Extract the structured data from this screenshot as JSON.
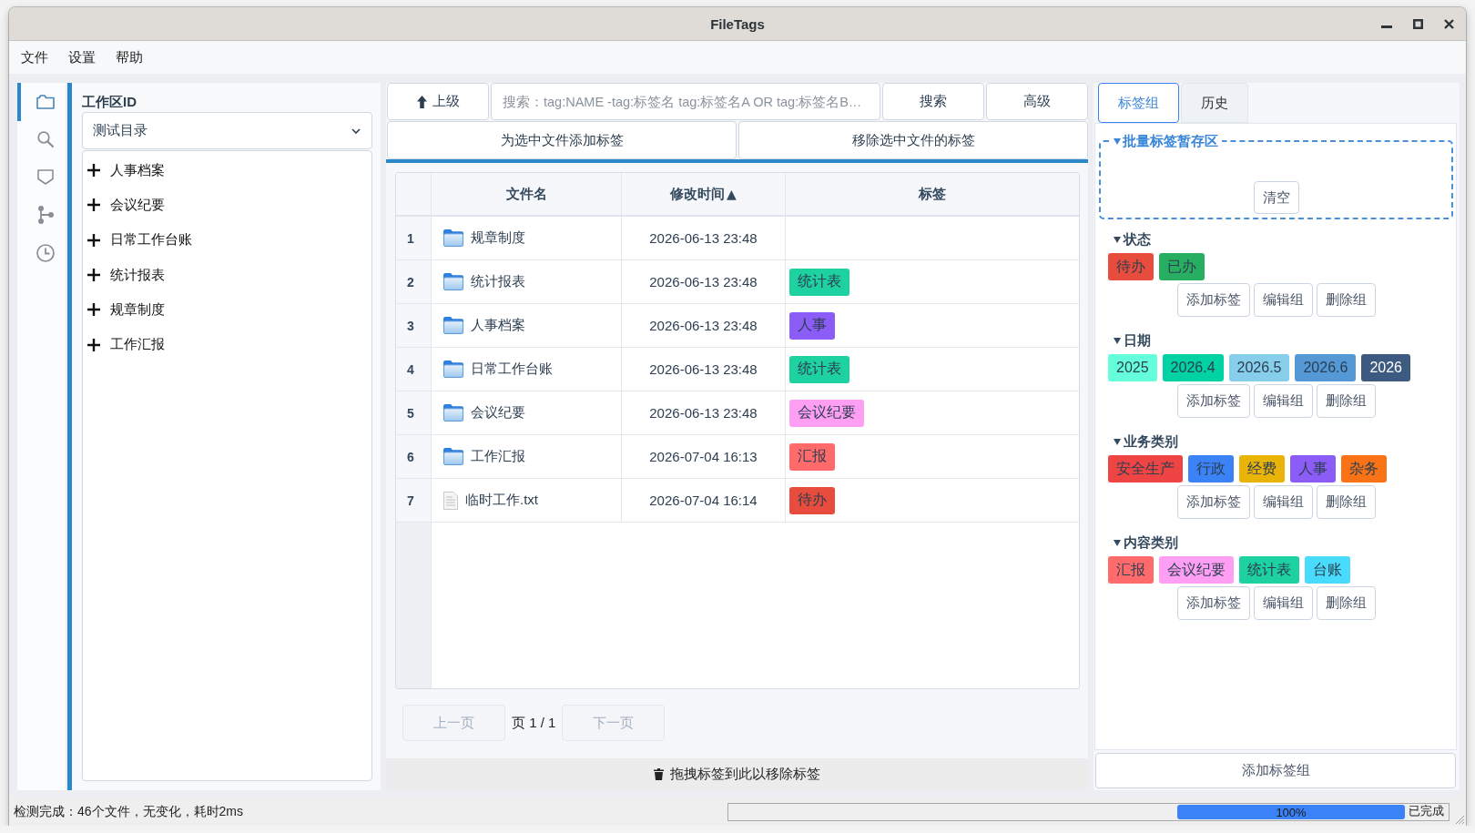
{
  "window": {
    "title": "FileTags"
  },
  "menu": [
    "文件",
    "设置",
    "帮助"
  ],
  "activity_bar": [
    {
      "kind": "files",
      "selected": true
    },
    {
      "kind": "search",
      "selected": false
    },
    {
      "kind": "tags",
      "selected": false
    },
    {
      "kind": "tree",
      "selected": false
    },
    {
      "kind": "history",
      "selected": false
    }
  ],
  "workspace": {
    "label": "工作区ID",
    "dropdown": {
      "value": "测试目录"
    },
    "tree": [
      {
        "label": "人事档案",
        "expanded": false
      },
      {
        "label": "会议纪要",
        "expanded": false
      },
      {
        "label": "日常工作台账",
        "expanded": false
      },
      {
        "label": "统计报表",
        "expanded": false
      },
      {
        "label": "规章制度",
        "expanded": false
      },
      {
        "label": "工作汇报",
        "expanded": false
      }
    ]
  },
  "toolbar": {
    "up_button": "上级",
    "search": {
      "placeholder": "搜索：tag:NAME -tag:标签名 tag:标签名A OR tag:标签名B…"
    },
    "search_button": "搜索",
    "advanced_button": "高级",
    "add_tags_button": "为选中文件添加标签",
    "remove_tags_button": "移除选中文件的标签"
  },
  "table": {
    "columns": [
      {
        "label": "文件名"
      },
      {
        "label": "修改时间",
        "sort_indicator": "▲"
      },
      {
        "label": "标签"
      }
    ],
    "rows": [
      {
        "index": "1",
        "kind": "folder",
        "name": "规章制度",
        "modified": "2026-06-13 23:48"
      },
      {
        "index": "2",
        "kind": "folder",
        "name": "统计报表",
        "modified": "2026-06-13 23:48",
        "tags": [
          {
            "label": "统计表",
            "color": "#1dd1a1"
          }
        ]
      },
      {
        "index": "3",
        "kind": "folder",
        "name": "人事档案",
        "modified": "2026-06-13 23:48",
        "tags": [
          {
            "label": "人事",
            "color": "#8b5cf6"
          }
        ]
      },
      {
        "index": "4",
        "kind": "folder",
        "name": "日常工作台账",
        "modified": "2026-06-13 23:48",
        "tags": [
          {
            "label": "统计表",
            "color": "#1dd1a1"
          }
        ]
      },
      {
        "index": "5",
        "kind": "folder",
        "name": "会议纪要",
        "modified": "2026-06-13 23:48",
        "tags": [
          {
            "label": "会议纪要",
            "color": "#ff9ff3"
          }
        ]
      },
      {
        "index": "6",
        "kind": "folder",
        "name": "工作汇报",
        "modified": "2026-07-04 16:13",
        "tags": [
          {
            "label": "汇报",
            "color": "#ff6b6b"
          }
        ]
      },
      {
        "index": "7",
        "kind": "file",
        "name": "临时工作.txt",
        "modified": "2026-07-04 16:14",
        "tags": [
          {
            "label": "待办",
            "color": "#e74c3c"
          }
        ]
      }
    ]
  },
  "pagination": {
    "previous": {
      "label": "上一页",
      "disabled": true
    },
    "page": "页 1 / 1",
    "next": {
      "label": "下一页",
      "disabled": true
    }
  },
  "drop_zone": {
    "text": "拖拽标签到此以移除标签"
  },
  "tag_panel": {
    "tabs": [
      {
        "label": "标签组",
        "selected": true
      },
      {
        "label": "历史",
        "selected": false
      }
    ],
    "staging": {
      "title": "批量标签暂存区",
      "expanded": true,
      "clear_button": "清空"
    },
    "groups": [
      {
        "name": "状态",
        "expanded": true,
        "tags": [
          {
            "label": "待办",
            "color": "#e74c3c"
          },
          {
            "label": "已办",
            "color": "#27ae60"
          }
        ],
        "actions": [
          "添加标签",
          "编辑组",
          "删除组"
        ]
      },
      {
        "name": "日期",
        "expanded": true,
        "tags": [
          {
            "label": "2025",
            "color": "#64ffda"
          },
          {
            "label": "2026.4",
            "color": "#00d2a3"
          },
          {
            "label": "2026.5",
            "color": "#87ceeb"
          },
          {
            "label": "2026.6",
            "color": "#5499d6"
          },
          {
            "label": "2026",
            "color": "#3d5a80"
          }
        ],
        "actions": [
          "添加标签",
          "编辑组",
          "删除组"
        ]
      },
      {
        "name": "业务类别",
        "expanded": true,
        "tags": [
          {
            "label": "安全生产",
            "color": "#ef4444"
          },
          {
            "label": "行政",
            "color": "#3b82f6"
          },
          {
            "label": "经费",
            "color": "#eab308"
          },
          {
            "label": "人事",
            "color": "#8b5cf6"
          },
          {
            "label": "杂务",
            "color": "#f97316"
          }
        ],
        "actions": [
          "添加标签",
          "编辑组",
          "删除组"
        ]
      },
      {
        "name": "内容类别",
        "expanded": true,
        "tags": [
          {
            "label": "汇报",
            "color": "#ff6b6b"
          },
          {
            "label": "会议纪要",
            "color": "#ff9ff3"
          },
          {
            "label": "统计表",
            "color": "#1dd1a1"
          },
          {
            "label": "台账",
            "color": "#48dbfb"
          }
        ],
        "actions": [
          "添加标签",
          "编辑组",
          "删除组"
        ]
      }
    ],
    "add_group_button": "添加标签组"
  },
  "status_bar": {
    "message": "检测完成：46个文件，无变化，耗时2ms",
    "progress": {
      "level": 1,
      "text": "100%"
    },
    "progress_label": "已完成"
  }
}
